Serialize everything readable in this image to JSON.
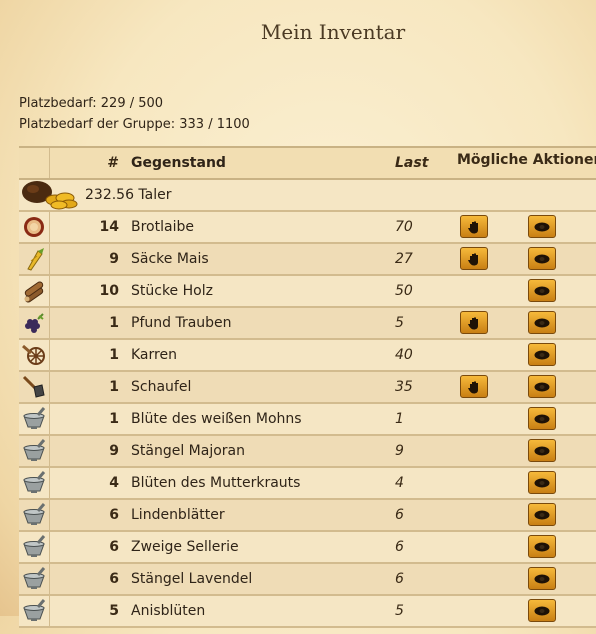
{
  "page_title": "Mein Inventar",
  "stats": {
    "capacity": "Platzbedarf: 229 / 500",
    "group_capacity": "Platzbedarf der Gruppe: 333 / 1100"
  },
  "table": {
    "headers": {
      "number": "#",
      "item": "Gegenstand",
      "load": "Last",
      "actions": "Mögliche Aktionen"
    },
    "currency": {
      "amount": "232.56 Taler",
      "icon": "money-bag-icon"
    },
    "rows": [
      {
        "num": "14",
        "name": "Brotlaibe",
        "load": "70",
        "icon": "bread-icon",
        "use_action": true
      },
      {
        "num": "9",
        "name": "Säcke Mais",
        "load": "27",
        "icon": "corn-icon",
        "use_action": true
      },
      {
        "num": "10",
        "name": "Stücke Holz",
        "load": "50",
        "icon": "wood-icon",
        "use_action": false
      },
      {
        "num": "1",
        "name": "Pfund Trauben",
        "load": "5",
        "icon": "grapes-icon",
        "use_action": true
      },
      {
        "num": "1",
        "name": "Karren",
        "load": "40",
        "icon": "cart-icon",
        "use_action": false
      },
      {
        "num": "1",
        "name": "Schaufel",
        "load": "35",
        "icon": "shovel-icon",
        "use_action": true
      },
      {
        "num": "1",
        "name": "Blüte des weißen Mohns",
        "load": "1",
        "icon": "mortar-icon",
        "use_action": false
      },
      {
        "num": "9",
        "name": "Stängel Majoran",
        "load": "9",
        "icon": "mortar-icon",
        "use_action": false
      },
      {
        "num": "4",
        "name": "Blüten des Mutterkrauts",
        "load": "4",
        "icon": "mortar-icon",
        "use_action": false
      },
      {
        "num": "6",
        "name": "Lindenblätter",
        "load": "6",
        "icon": "mortar-icon",
        "use_action": false
      },
      {
        "num": "6",
        "name": "Zweige Sellerie",
        "load": "6",
        "icon": "mortar-icon",
        "use_action": false
      },
      {
        "num": "6",
        "name": "Stängel Lavendel",
        "load": "6",
        "icon": "mortar-icon",
        "use_action": false
      },
      {
        "num": "5",
        "name": "Anisblüten",
        "load": "5",
        "icon": "mortar-icon",
        "use_action": false
      }
    ]
  }
}
